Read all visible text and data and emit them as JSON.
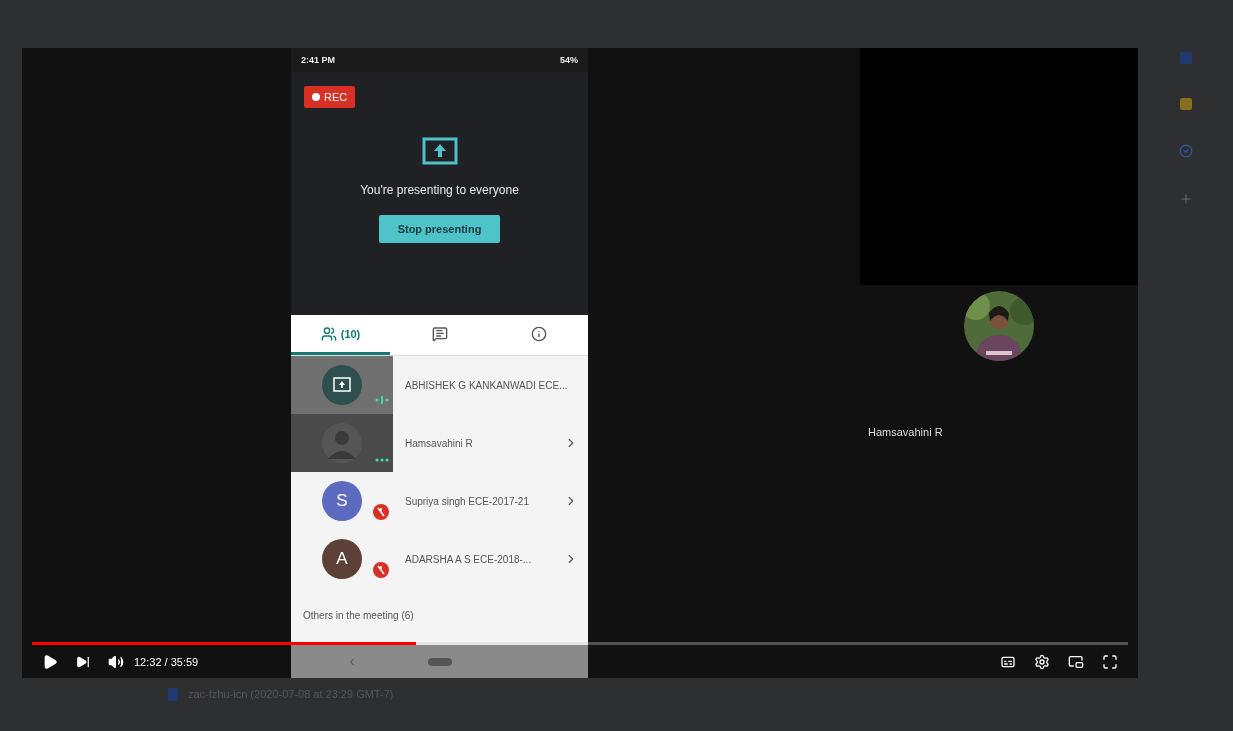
{
  "player": {
    "progress": {
      "level": 0.35
    },
    "time": "12:32 / 35:59"
  },
  "phone": {
    "status_time": "2:41 PM",
    "battery": "54%",
    "rec_label": "REC",
    "presenting_text": "You're presenting to everyone",
    "stop_button": "Stop presenting",
    "tabs": [
      {
        "kind": "people",
        "label": "(10)",
        "selected": true
      },
      {
        "kind": "chat",
        "selected": false
      },
      {
        "kind": "info",
        "selected": false
      }
    ],
    "participants": [
      {
        "kind": "presenting",
        "name": "ABHISHEK G KANKANWADI ECE...",
        "speaking": true,
        "muted": false,
        "chevron": false
      },
      {
        "name": "Hamsavahini R",
        "speaking": false,
        "muted": false,
        "chevron": true
      },
      {
        "kind": "letter",
        "letter": "S",
        "color": "#5c6bc0",
        "name": "Supriya singh ECE-2017-21",
        "muted": true,
        "chevron": true
      },
      {
        "kind": "letter",
        "letter": "A",
        "color": "#5d4037",
        "name": "ADARSHA A S ECE-2018-...",
        "muted": true,
        "chevron": true
      }
    ],
    "others_heading": "Others in the meeting (6)"
  },
  "tile": {
    "name": "Hamsavahini R"
  },
  "file_row": {
    "name": "zac-fzhu-icn (2020-07-08 at 23:29 GMT-7)"
  }
}
